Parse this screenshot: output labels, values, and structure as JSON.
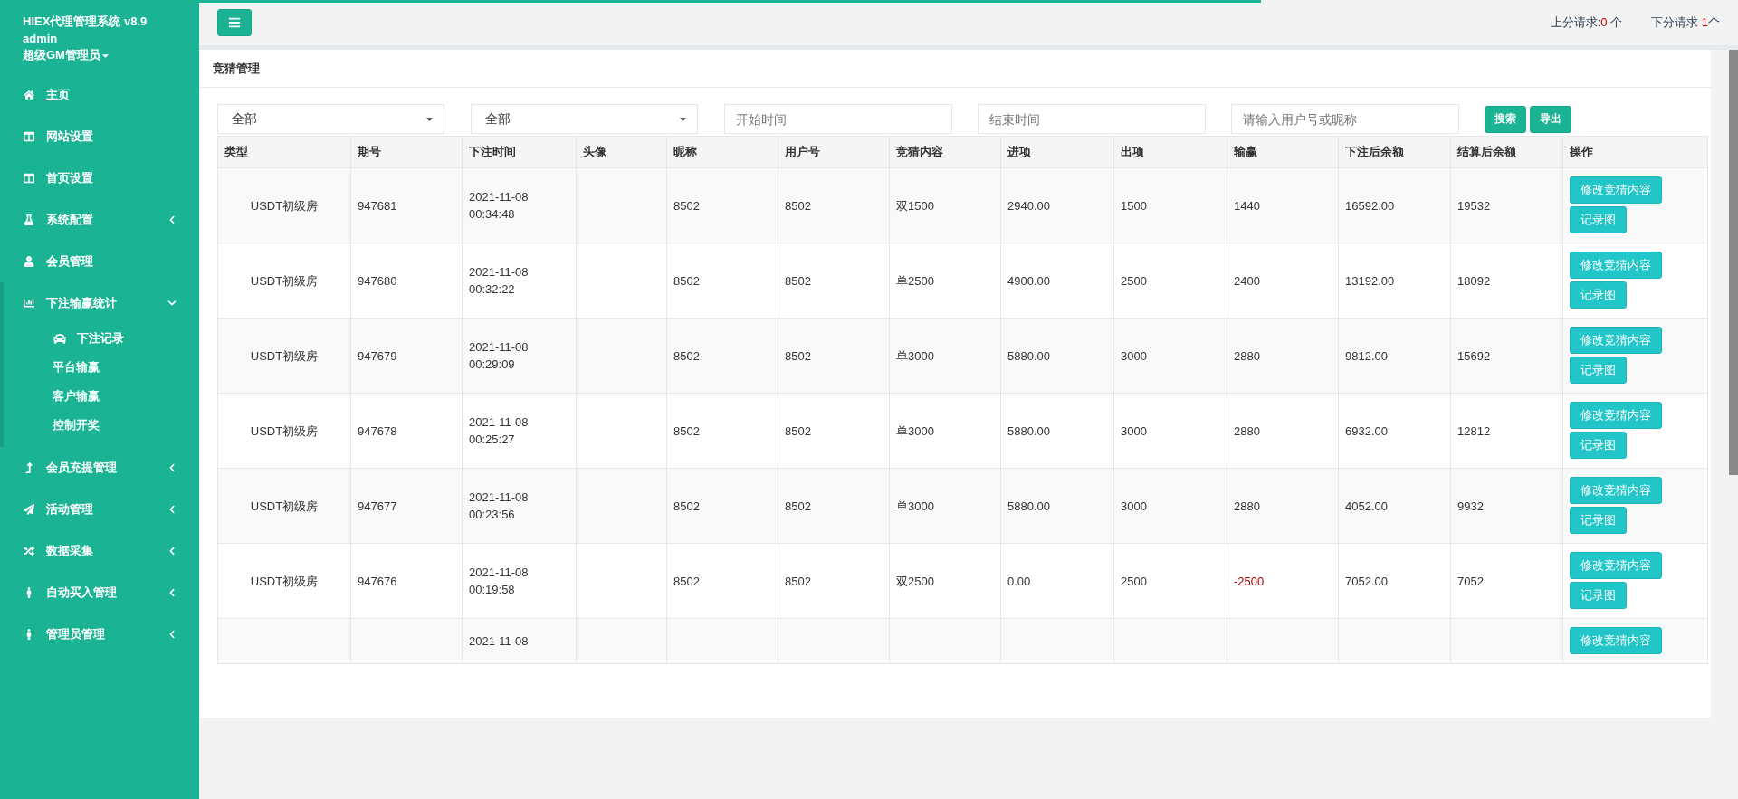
{
  "sidebar": {
    "title": "HIEX代理管理系统 v8.9",
    "user": "admin",
    "role": "超级GM管理员",
    "items": [
      {
        "label": "主页",
        "expandable": false,
        "expanded": false
      },
      {
        "label": "网站设置",
        "expandable": false,
        "expanded": false
      },
      {
        "label": "首页设置",
        "expandable": false,
        "expanded": false
      },
      {
        "label": "系统配置",
        "expandable": true,
        "expanded": false
      },
      {
        "label": "会员管理",
        "expandable": false,
        "expanded": false
      },
      {
        "label": "下注输赢统计",
        "expandable": true,
        "expanded": true,
        "children": [
          {
            "label": "下注记录",
            "selected": true
          },
          {
            "label": "平台输赢",
            "selected": false
          },
          {
            "label": "客户输赢",
            "selected": false
          },
          {
            "label": "控制开奖",
            "selected": false
          }
        ]
      },
      {
        "label": "会员充提管理",
        "expandable": true,
        "expanded": false
      },
      {
        "label": "活动管理",
        "expandable": true,
        "expanded": false
      },
      {
        "label": "数据采集",
        "expandable": true,
        "expanded": false
      },
      {
        "label": "自动买入管理",
        "expandable": true,
        "expanded": false
      },
      {
        "label": "管理员管理",
        "expandable": true,
        "expanded": false
      }
    ]
  },
  "loading_bar": {
    "level": 0.69
  },
  "header": {
    "requests": [
      {
        "label": "上分请求:",
        "count": "0",
        "unit": " 个"
      },
      {
        "label": "下分请求 ",
        "count": "1",
        "unit": "个"
      }
    ]
  },
  "panel": {
    "title": "竞猜管理"
  },
  "filters": {
    "selects": [
      "全部",
      "全部"
    ],
    "fields": [
      {
        "placeholder": "开始时间"
      },
      {
        "placeholder": "结束时间"
      },
      {
        "placeholder": "请输入用户号或昵称"
      }
    ],
    "buttons": [
      "搜索",
      "导出"
    ]
  },
  "table": {
    "columns": [
      "类型",
      "期号",
      "下注时间",
      "头像",
      "昵称",
      "用户号",
      "竞猜内容",
      "进项",
      "出项",
      "输赢",
      "下注后余额",
      "结算后余额",
      "操作"
    ],
    "rows": [
      {
        "type": "USDT初级房",
        "period": "947681",
        "date": "2021-11-08",
        "time": "00:34:48",
        "nickname": "8502",
        "user": "8502",
        "content": "双1500",
        "in": "2940.00",
        "out": "1500",
        "result": "1440",
        "loss": false,
        "after_bet": "16592.00",
        "after_settle": "19532",
        "actions": [
          "修改竞猜内容",
          "记录图"
        ]
      },
      {
        "type": "USDT初级房",
        "period": "947680",
        "date": "2021-11-08",
        "time": "00:32:22",
        "nickname": "8502",
        "user": "8502",
        "content": "单2500",
        "in": "4900.00",
        "out": "2500",
        "result": "2400",
        "loss": false,
        "after_bet": "13192.00",
        "after_settle": "18092",
        "actions": [
          "修改竞猜内容",
          "记录图"
        ]
      },
      {
        "type": "USDT初级房",
        "period": "947679",
        "date": "2021-11-08",
        "time": "00:29:09",
        "nickname": "8502",
        "user": "8502",
        "content": "单3000",
        "in": "5880.00",
        "out": "3000",
        "result": "2880",
        "loss": false,
        "after_bet": "9812.00",
        "after_settle": "15692",
        "actions": [
          "修改竞猜内容",
          "记录图"
        ]
      },
      {
        "type": "USDT初级房",
        "period": "947678",
        "date": "2021-11-08",
        "time": "00:25:27",
        "nickname": "8502",
        "user": "8502",
        "content": "单3000",
        "in": "5880.00",
        "out": "3000",
        "result": "2880",
        "loss": false,
        "after_bet": "6932.00",
        "after_settle": "12812",
        "actions": [
          "修改竞猜内容",
          "记录图"
        ]
      },
      {
        "type": "USDT初级房",
        "period": "947677",
        "date": "2021-11-08",
        "time": "00:23:56",
        "nickname": "8502",
        "user": "8502",
        "content": "单3000",
        "in": "5880.00",
        "out": "3000",
        "result": "2880",
        "loss": false,
        "after_bet": "4052.00",
        "after_settle": "9932",
        "actions": [
          "修改竞猜内容",
          "记录图"
        ]
      },
      {
        "type": "USDT初级房",
        "period": "947676",
        "date": "2021-11-08",
        "time": "00:19:58",
        "nickname": "8502",
        "user": "8502",
        "content": "双2500",
        "in": "0.00",
        "out": "2500",
        "result": "-2500",
        "loss": true,
        "after_bet": "7052.00",
        "after_settle": "7052",
        "actions": [
          "修改竞猜内容",
          "记录图"
        ]
      },
      {
        "date": "2021-11-08",
        "actions": [
          "修改竞猜内容"
        ]
      }
    ]
  }
}
